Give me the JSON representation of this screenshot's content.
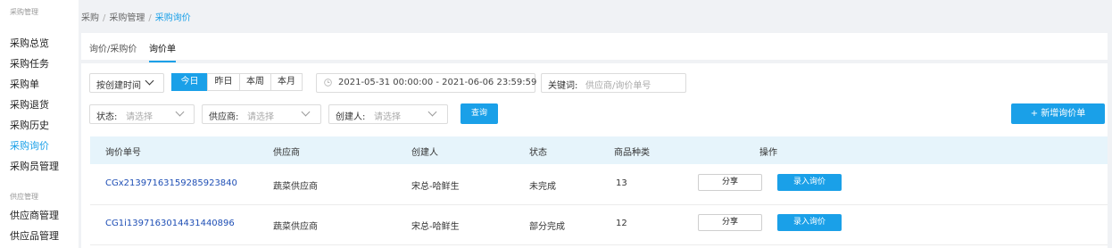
{
  "sidebar": {
    "group1_title": "采购管理",
    "group1_items": [
      "采购总览",
      "采购任务",
      "采购单",
      "采购退货",
      "采购历史",
      "采购询价",
      "采购员管理"
    ],
    "active_item": "采购询价",
    "group2_title": "供应管理",
    "group2_items": [
      "供应商管理",
      "供应品管理"
    ]
  },
  "breadcrumb": {
    "items": [
      "采购",
      "采购管理",
      "采购询价"
    ],
    "separator": "/"
  },
  "tabs": {
    "tab1": "询价/采购价",
    "tab2": "询价单",
    "active": "询价单"
  },
  "filters": {
    "time_select": "按创建时间",
    "date_buttons": [
      "今日",
      "昨日",
      "本周",
      "本月"
    ],
    "active_date_button": "今日",
    "date_range": "2021-05-31 00:00:00 - 2021-06-06 23:59:59",
    "keyword_label": "关键词:",
    "keyword_placeholder": "供应商/询价单号",
    "status_label": "状态:",
    "supplier_label": "供应商:",
    "creator_label": "创建人:",
    "select_placeholder": "请选择",
    "query_button": "查询",
    "new_button": "+ 新增询价单"
  },
  "table": {
    "columns": [
      "询价单号",
      "供应商",
      "创建人",
      "状态",
      "商品种类",
      "操作"
    ],
    "rows": [
      {
        "id": "CGx21397163159285923840",
        "supplier": "蔬菜供应商",
        "creator": "宋总-哈鲜生",
        "status": "未完成",
        "count": "13",
        "share": "分享",
        "enter": "录入询价"
      },
      {
        "id": "CG1i1397163014431440896",
        "supplier": "蔬菜供应商",
        "creator": "宋总-哈鲜生",
        "status": "部分完成",
        "count": "12",
        "share": "分享",
        "enter": "录入询价"
      }
    ]
  },
  "colors": {
    "accent": "#1aa0e8",
    "link": "#1f4fb5",
    "header_bg": "#e6f4fb",
    "page_bg": "#f0f2f5"
  },
  "icons": [
    "chevron-down-icon",
    "clock-icon",
    "plus-icon"
  ]
}
